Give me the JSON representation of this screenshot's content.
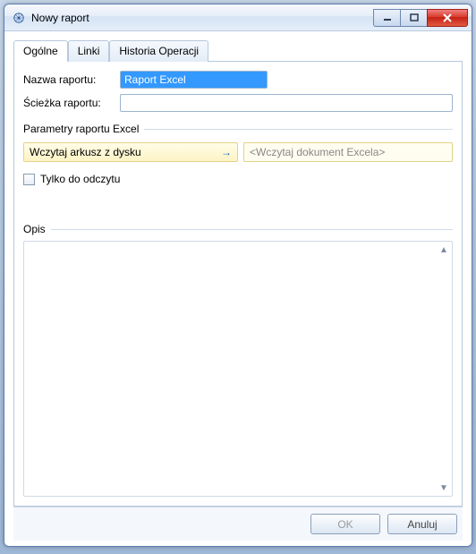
{
  "window": {
    "title": "Nowy raport"
  },
  "tabs": {
    "general": "Ogólne",
    "links": "Linki",
    "history": "Historia Operacji"
  },
  "form": {
    "report_name_label": "Nazwa raportu:",
    "report_name_value": "Raport Excel",
    "report_path_label": "Ścieżka raportu:",
    "report_path_value": "",
    "params_group": "Parametry raportu Excel",
    "load_button": "Wczytaj arkusz z dysku",
    "load_placeholder": "<Wczytaj dokument Excela>",
    "readonly_label": "Tylko do odczytu",
    "readonly_checked": false,
    "opis_label": "Opis",
    "opis_value": ""
  },
  "buttons": {
    "ok": "OK",
    "cancel": "Anuluj"
  },
  "icons": {
    "app": "app-icon",
    "arrow": "→"
  }
}
